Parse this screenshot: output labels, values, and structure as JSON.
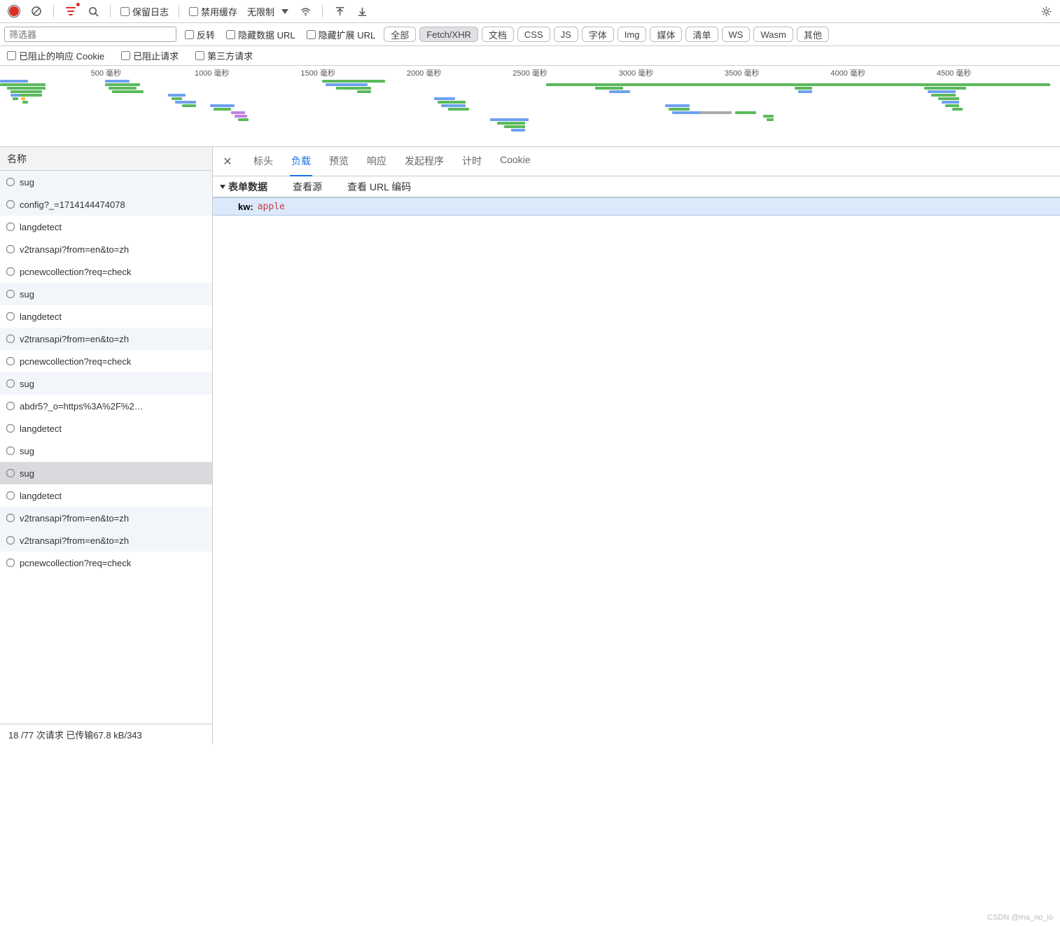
{
  "toolbar": {
    "preserve_log": "保留日志",
    "disable_cache": "禁用缓存",
    "throttling": "无限制"
  },
  "filter": {
    "placeholder": "筛选器",
    "invert": "反转",
    "hide_data_url": "隐藏数据 URL",
    "hide_ext_url": "隐藏扩展 URL",
    "types": [
      "全部",
      "Fetch/XHR",
      "文档",
      "CSS",
      "JS",
      "字体",
      "Img",
      "媒体",
      "清单",
      "WS",
      "Wasm",
      "其他"
    ],
    "active_type_index": 1
  },
  "row2": {
    "blocked_cookies": "已阻止的响应 Cookie",
    "blocked_requests": "已阻止请求",
    "third_party": "第三方请求"
  },
  "timeline": {
    "unit": "毫秒",
    "ticks": [
      500,
      1000,
      1500,
      2000,
      2500,
      3000,
      3500,
      4000,
      4500
    ]
  },
  "requests": {
    "header": "名称",
    "items": [
      "sug",
      "config?_=1714144474078",
      "langdetect",
      "v2transapi?from=en&to=zh",
      "pcnewcollection?req=check",
      "sug",
      "langdetect",
      "v2transapi?from=en&to=zh",
      "pcnewcollection?req=check",
      "sug",
      "abdr5?_o=https%3A%2F%2…",
      "langdetect",
      "sug",
      "sug",
      "langdetect",
      "v2transapi?from=en&to=zh",
      "v2transapi?from=en&to=zh",
      "pcnewcollection?req=check"
    ],
    "selected_index": 13
  },
  "detail_tabs": {
    "items": [
      "标头",
      "负载",
      "预览",
      "响应",
      "发起程序",
      "计时",
      "Cookie"
    ],
    "active_index": 1
  },
  "payload": {
    "section": "表单数据",
    "view_source": "查看源",
    "view_url_encoded": "查看 URL 编码",
    "entries": [
      {
        "key": "kw:",
        "value": "apple"
      }
    ]
  },
  "status": "18 /77 次请求  已传输67.8 kB/343",
  "watermark": "CSDN @ma_no_lo"
}
